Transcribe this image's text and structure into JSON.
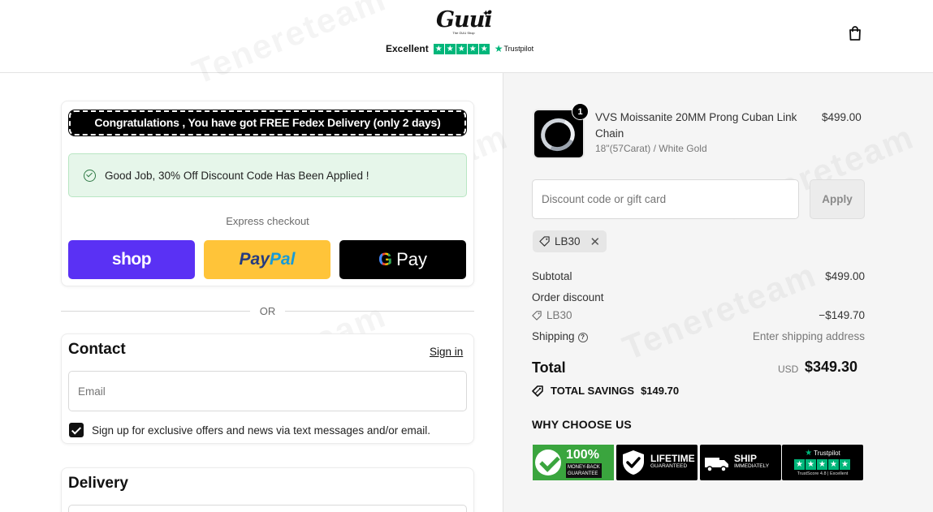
{
  "header": {
    "logo_text": "Guui",
    "logo_subtitle": "The GUU Shop",
    "trustpilot_rating": "Excellent",
    "trustpilot_name": "Trustpilot",
    "cart_icon": "shopping-bag-icon"
  },
  "left": {
    "congrats_banner": "Congratulations , You have got FREE Fedex Delivery (only 2 days)",
    "discount_message": "Good Job, 30% Off Discount Code Has Been Applied !",
    "express_checkout_label": "Express checkout",
    "express_buttons": {
      "shop": "shop",
      "paypal_part1": "Pay",
      "paypal_part2": "Pal",
      "gpay_g": "G",
      "gpay_text": "Pay"
    },
    "or_label": "OR",
    "contact": {
      "title": "Contact",
      "sign_in": "Sign in",
      "email_placeholder": "Email",
      "sms_opt_in": "Sign up for exclusive offers and news via text messages and/or email.",
      "sms_checked": true
    },
    "delivery": {
      "title": "Delivery"
    }
  },
  "summary": {
    "product": {
      "quantity": "1",
      "name": "VVS Moissanite 20MM Prong Cuban Link Chain",
      "variant": "18\"(57Carat) / White Gold",
      "price": "$499.00"
    },
    "discount_placeholder": "Discount code or gift card",
    "apply_label": "Apply",
    "applied_code": "LB30",
    "subtotal_label": "Subtotal",
    "subtotal_value": "$499.00",
    "order_discount_label": "Order discount",
    "order_discount_code": "LB30",
    "order_discount_value": "−$149.70",
    "shipping_label": "Shipping",
    "shipping_value": "Enter shipping address",
    "total_label": "Total",
    "total_currency": "USD",
    "total_value": "$349.30",
    "savings_label": "TOTAL SAVINGS",
    "savings_value": "$149.70",
    "why_choose_title": "WHY CHOOSE US",
    "badges": {
      "money_back_pct": "100%",
      "money_back_line1": "MONEY-BACK",
      "money_back_line2": "GUARANTEE",
      "lifetime_line1": "LIFETIME",
      "lifetime_line2": "GUARANTEED",
      "ship_line1": "SHIP",
      "ship_line2": "IMMEDIATELY",
      "trustpilot_name": "Trustpilot",
      "trustscore": "TrustScore 4.8 | Excellent"
    }
  },
  "watermark_text": "Tenereteam",
  "colors": {
    "shop_purple": "#5a31f4",
    "paypal_yellow": "#ffc439",
    "trustpilot_green": "#00b67a",
    "success_bg": "#e6f6ea",
    "summary_bg": "#f5f5f5"
  }
}
